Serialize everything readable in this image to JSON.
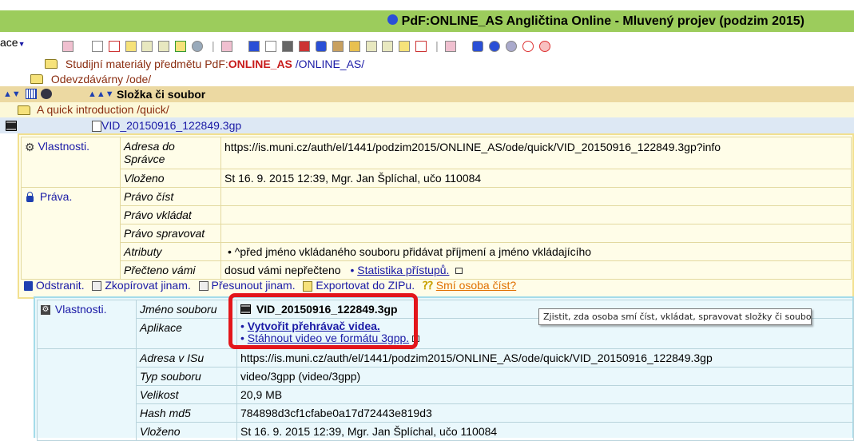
{
  "header": {
    "title": "PdF:ONLINE_AS Angličtina Online - Mluvený projev (podzim 2015)",
    "accent": "#9ccc5c"
  },
  "toolbar": {
    "left_label": "ace"
  },
  "path": {
    "line1_prefix": "Studijní materiály předmětu PdF:",
    "line1_bold": "ONLINE_AS",
    "line1_suffix": " /ONLINE_AS/",
    "line2": "Odevzdávárny /ode/"
  },
  "list_header": {
    "label": "Složka či soubor"
  },
  "quick": {
    "label": "A quick introduction /quick/"
  },
  "file_row": {
    "label": "VID_20150916_122849.3gp"
  },
  "props1": {
    "vlastnosti": "Vlastnosti.",
    "adresa_label": "Adresa do Správce",
    "adresa_value": "https://is.muni.cz/auth/el/1441/podzim2015/ONLINE_AS/ode/quick/VID_20150916_122849.3gp?info",
    "vlozeno_label": "Vloženo",
    "vlozeno_value": "St 16. 9. 2015 12:39, Mgr. Jan Šplíchal, učo 110084",
    "prava": "Práva.",
    "pravo_cist": "Právo číst",
    "pravo_vkladat": "Právo vkládat",
    "pravo_spravovat": "Právo spravovat",
    "atributy_label": "Atributy",
    "atributy_value": "• ^před jméno vkládaného souboru přidávat příjmení a jméno vkládajícího",
    "precteno_label": "Přečteno vámi",
    "precteno_value": "dosud vámi nepřečteno",
    "statistika": "Statistika přístupů."
  },
  "actions": {
    "odstranit": "Odstranit.",
    "zkopirovat": "Zkopírovat jinam.",
    "presunout": "Přesunout jinam.",
    "exportovat": "Exportovat do ZIPu.",
    "smi": "Smí osoba číst?"
  },
  "props2": {
    "vlastnosti": "Vlastnosti.",
    "jmeno_label": "Jméno souboru",
    "jmeno_value": "VID_20150916_122849.3gp",
    "aplikace_label": "Aplikace",
    "vytvorit": "Vytvořit přehrávač videa.",
    "stahnout": "Stáhnout video ve formátu 3gpp.",
    "adresa_label": "Adresa v ISu",
    "adresa_value": "https://is.muni.cz/auth/el/1441/podzim2015/ONLINE_AS/ode/quick/VID_20150916_122849.3gp",
    "typ_label": "Typ souboru",
    "typ_value": "video/3gpp (video/3gpp)",
    "velikost_label": "Velikost",
    "velikost_value": "20,9 MB",
    "hash_label": "Hash md5",
    "hash_value": "784898d3cf1cfabe0a17d72443e819d3",
    "vlozeno_label": "Vloženo",
    "vlozeno_value": "St 16. 9. 2015 12:39, Mgr. Jan Šplíchal, učo 110084"
  },
  "tooltip": {
    "text": "Zjistit, zda osoba smí číst, vkládat, spravovat složky či soubory."
  }
}
